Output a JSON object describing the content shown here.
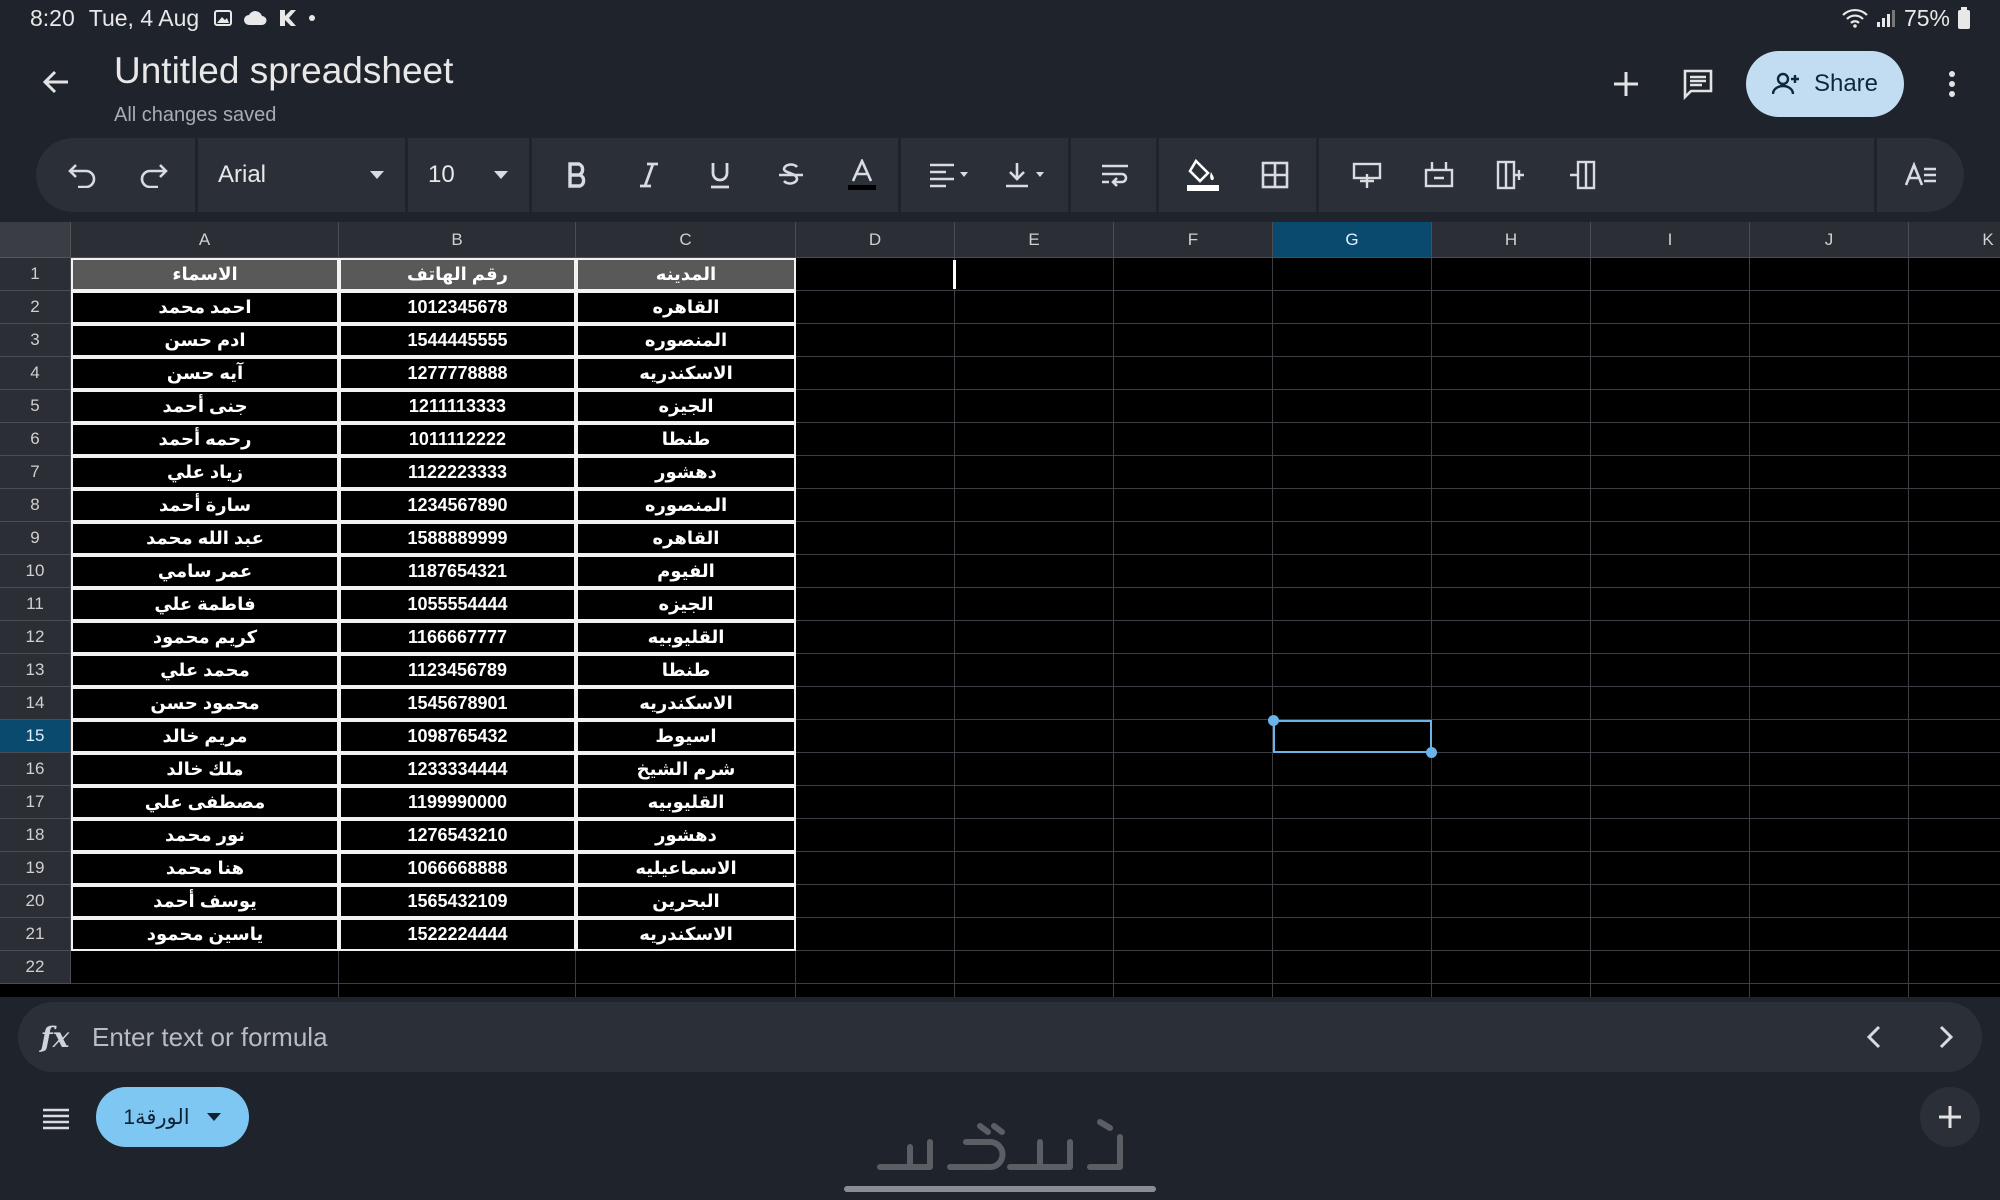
{
  "status_bar": {
    "time": "8:20",
    "date": "Tue, 4 Aug",
    "battery": "75%",
    "icons": [
      "image-icon",
      "cloud-icon",
      "k-icon",
      "dot-icon",
      "wifi-icon",
      "signal-icon",
      "battery-icon"
    ]
  },
  "header": {
    "title": "Untitled spreadsheet",
    "subtitle": "All changes saved",
    "share_label": "Share"
  },
  "toolbar": {
    "font": "Arial",
    "font_size": "10",
    "buttons": [
      "undo",
      "redo",
      "bold",
      "italic",
      "underline",
      "strikethrough",
      "text-color",
      "horizontal-align",
      "vertical-align",
      "wrap",
      "fill-color",
      "borders",
      "insert-row-above",
      "insert-row-below",
      "insert-column-left",
      "insert-column-right",
      "text-format"
    ]
  },
  "grid": {
    "columns": [
      "A",
      "B",
      "C",
      "D",
      "E",
      "F",
      "G",
      "H",
      "I",
      "J",
      "K"
    ],
    "selected_column": "G",
    "selected_row": "15",
    "rows": [
      "1",
      "2",
      "3",
      "4",
      "5",
      "6",
      "7",
      "8",
      "9",
      "10",
      "11",
      "12",
      "13",
      "14",
      "15",
      "16",
      "17",
      "18",
      "19",
      "20",
      "21",
      "22"
    ],
    "table_header": [
      "الاسماء",
      "رقم الهاتف",
      "المدينه"
    ],
    "table_rows": [
      [
        "احمد محمد",
        "1012345678",
        "القاهره"
      ],
      [
        "ادم حسن",
        "1544445555",
        "المنصوره"
      ],
      [
        "آيه حسن",
        "1277778888",
        "الاسكندريه"
      ],
      [
        "جنى أحمد",
        "1211113333",
        "الجيزه"
      ],
      [
        "رحمه أحمد",
        "1011112222",
        "طنطا"
      ],
      [
        "زياد علي",
        "1122223333",
        "دهشور"
      ],
      [
        "سارة أحمد",
        "1234567890",
        "المنصوره"
      ],
      [
        "عبد الله محمد",
        "1588889999",
        "القاهره"
      ],
      [
        "عمر سامي",
        "1187654321",
        "الفيوم"
      ],
      [
        "فاطمة علي",
        "1055554444",
        "الجيزه"
      ],
      [
        "كريم محمود",
        "1166667777",
        "القليوبيه"
      ],
      [
        "محمد علي",
        "1123456789",
        "طنطا"
      ],
      [
        "محمود حسن",
        "1545678901",
        "الاسكندريه"
      ],
      [
        "مريم خالد",
        "1098765432",
        "اسيوط"
      ],
      [
        "ملك خالد",
        "1233334444",
        "شرم الشيخ"
      ],
      [
        "مصطفى علي",
        "1199990000",
        "القليوبيه"
      ],
      [
        "نور محمد",
        "1276543210",
        "دهشور"
      ],
      [
        "هنا محمد",
        "1066668888",
        "الاسماعيليه"
      ],
      [
        "يوسف أحمد",
        "1565432109",
        "البحرين"
      ],
      [
        "ياسين محمود",
        "1522224444",
        "الاسكندريه"
      ]
    ]
  },
  "formula_bar": {
    "placeholder": "Enter text or formula"
  },
  "sheet_tab": {
    "label": "الورقة1"
  },
  "colors": {
    "accent": "#6ab4ec",
    "share_bg": "#c2dcf2",
    "sheet_tab_bg": "#7fc7f3",
    "table_header_bg": "#595959"
  }
}
